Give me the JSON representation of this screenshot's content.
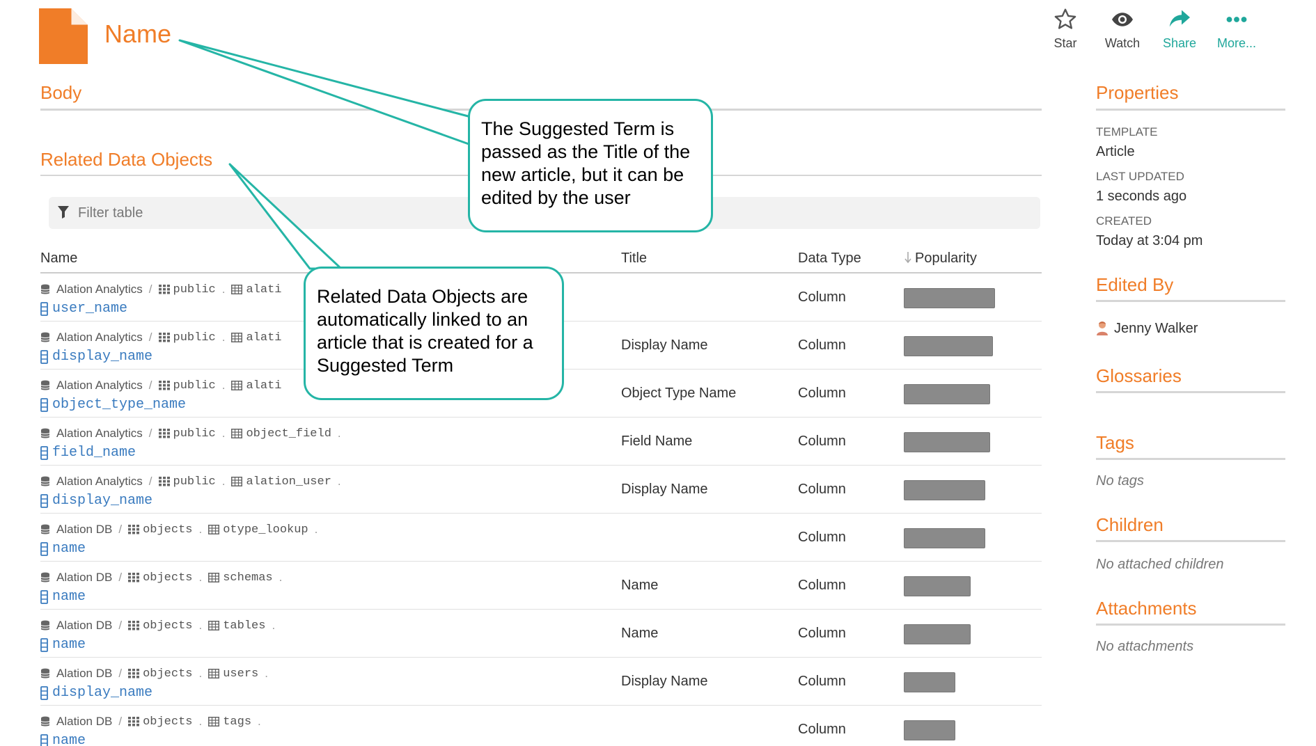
{
  "header": {
    "title": "Name",
    "actions": [
      {
        "label": "Star",
        "icon": "star-icon"
      },
      {
        "label": "Watch",
        "icon": "eye-icon"
      },
      {
        "label": "Share",
        "icon": "share-icon"
      },
      {
        "label": "More...",
        "icon": "more-icon"
      }
    ]
  },
  "main": {
    "body_heading": "Body",
    "related_heading": "Related Data Objects",
    "filter_placeholder": "Filter table",
    "columns": {
      "name": "Name",
      "title": "Title",
      "data_type": "Data Type",
      "popularity": "Popularity"
    },
    "rows": [
      {
        "source": "Alation Analytics",
        "schema": "public",
        "table": "alati",
        "column": "user_name",
        "title": "",
        "type": "Column",
        "popularity": 0.9
      },
      {
        "source": "Alation Analytics",
        "schema": "public",
        "table": "alati",
        "column": "display_name",
        "title": "Display Name",
        "type": "Column",
        "popularity": 0.88
      },
      {
        "source": "Alation Analytics",
        "schema": "public",
        "table": "alati",
        "column": "object_type_name",
        "title": "Object Type Name",
        "type": "Column",
        "popularity": 0.85
      },
      {
        "source": "Alation Analytics",
        "schema": "public",
        "table": "object_field",
        "column": "field_name",
        "title": "Field Name",
        "type": "Column",
        "popularity": 0.85
      },
      {
        "source": "Alation Analytics",
        "schema": "public",
        "table": "alation_user",
        "column": "display_name",
        "title": "Display Name",
        "type": "Column",
        "popularity": 0.8
      },
      {
        "source": "Alation DB",
        "schema": "objects",
        "table": "otype_lookup",
        "column": "name",
        "title": "",
        "type": "Column",
        "popularity": 0.8
      },
      {
        "source": "Alation DB",
        "schema": "objects",
        "table": "schemas",
        "column": "name",
        "title": "Name",
        "type": "Column",
        "popularity": 0.66
      },
      {
        "source": "Alation DB",
        "schema": "objects",
        "table": "tables",
        "column": "name",
        "title": "Name",
        "type": "Column",
        "popularity": 0.66
      },
      {
        "source": "Alation DB",
        "schema": "objects",
        "table": "users",
        "column": "display_name",
        "title": "Display Name",
        "type": "Column",
        "popularity": 0.51
      },
      {
        "source": "Alation DB",
        "schema": "objects",
        "table": "tags",
        "column": "name",
        "title": "",
        "type": "Column",
        "popularity": 0.51
      }
    ]
  },
  "sidebar": {
    "properties_heading": "Properties",
    "template_label": "TEMPLATE",
    "template_value": "Article",
    "last_updated_label": "LAST UPDATED",
    "last_updated_value": "1 seconds ago",
    "created_label": "CREATED",
    "created_value": "Today at 3:04 pm",
    "edited_by_heading": "Edited By",
    "editor": "Jenny Walker",
    "glossaries_heading": "Glossaries",
    "tags_heading": "Tags",
    "tags_empty": "No tags",
    "children_heading": "Children",
    "children_empty": "No attached children",
    "attachments_heading": "Attachments",
    "attachments_empty": "No attachments"
  },
  "callouts": {
    "title_note": "The Suggested Term is passed as the Title of the new article, but it can be edited by the user",
    "related_note": "Related Data Objects are automatically linked to an article that is created for a Suggested Term"
  },
  "colors": {
    "accent": "#f07d28",
    "teal": "#1fa79b",
    "callout_border": "#25b5a6",
    "link": "#3a7bbf",
    "bar": "#8a8a8a"
  }
}
